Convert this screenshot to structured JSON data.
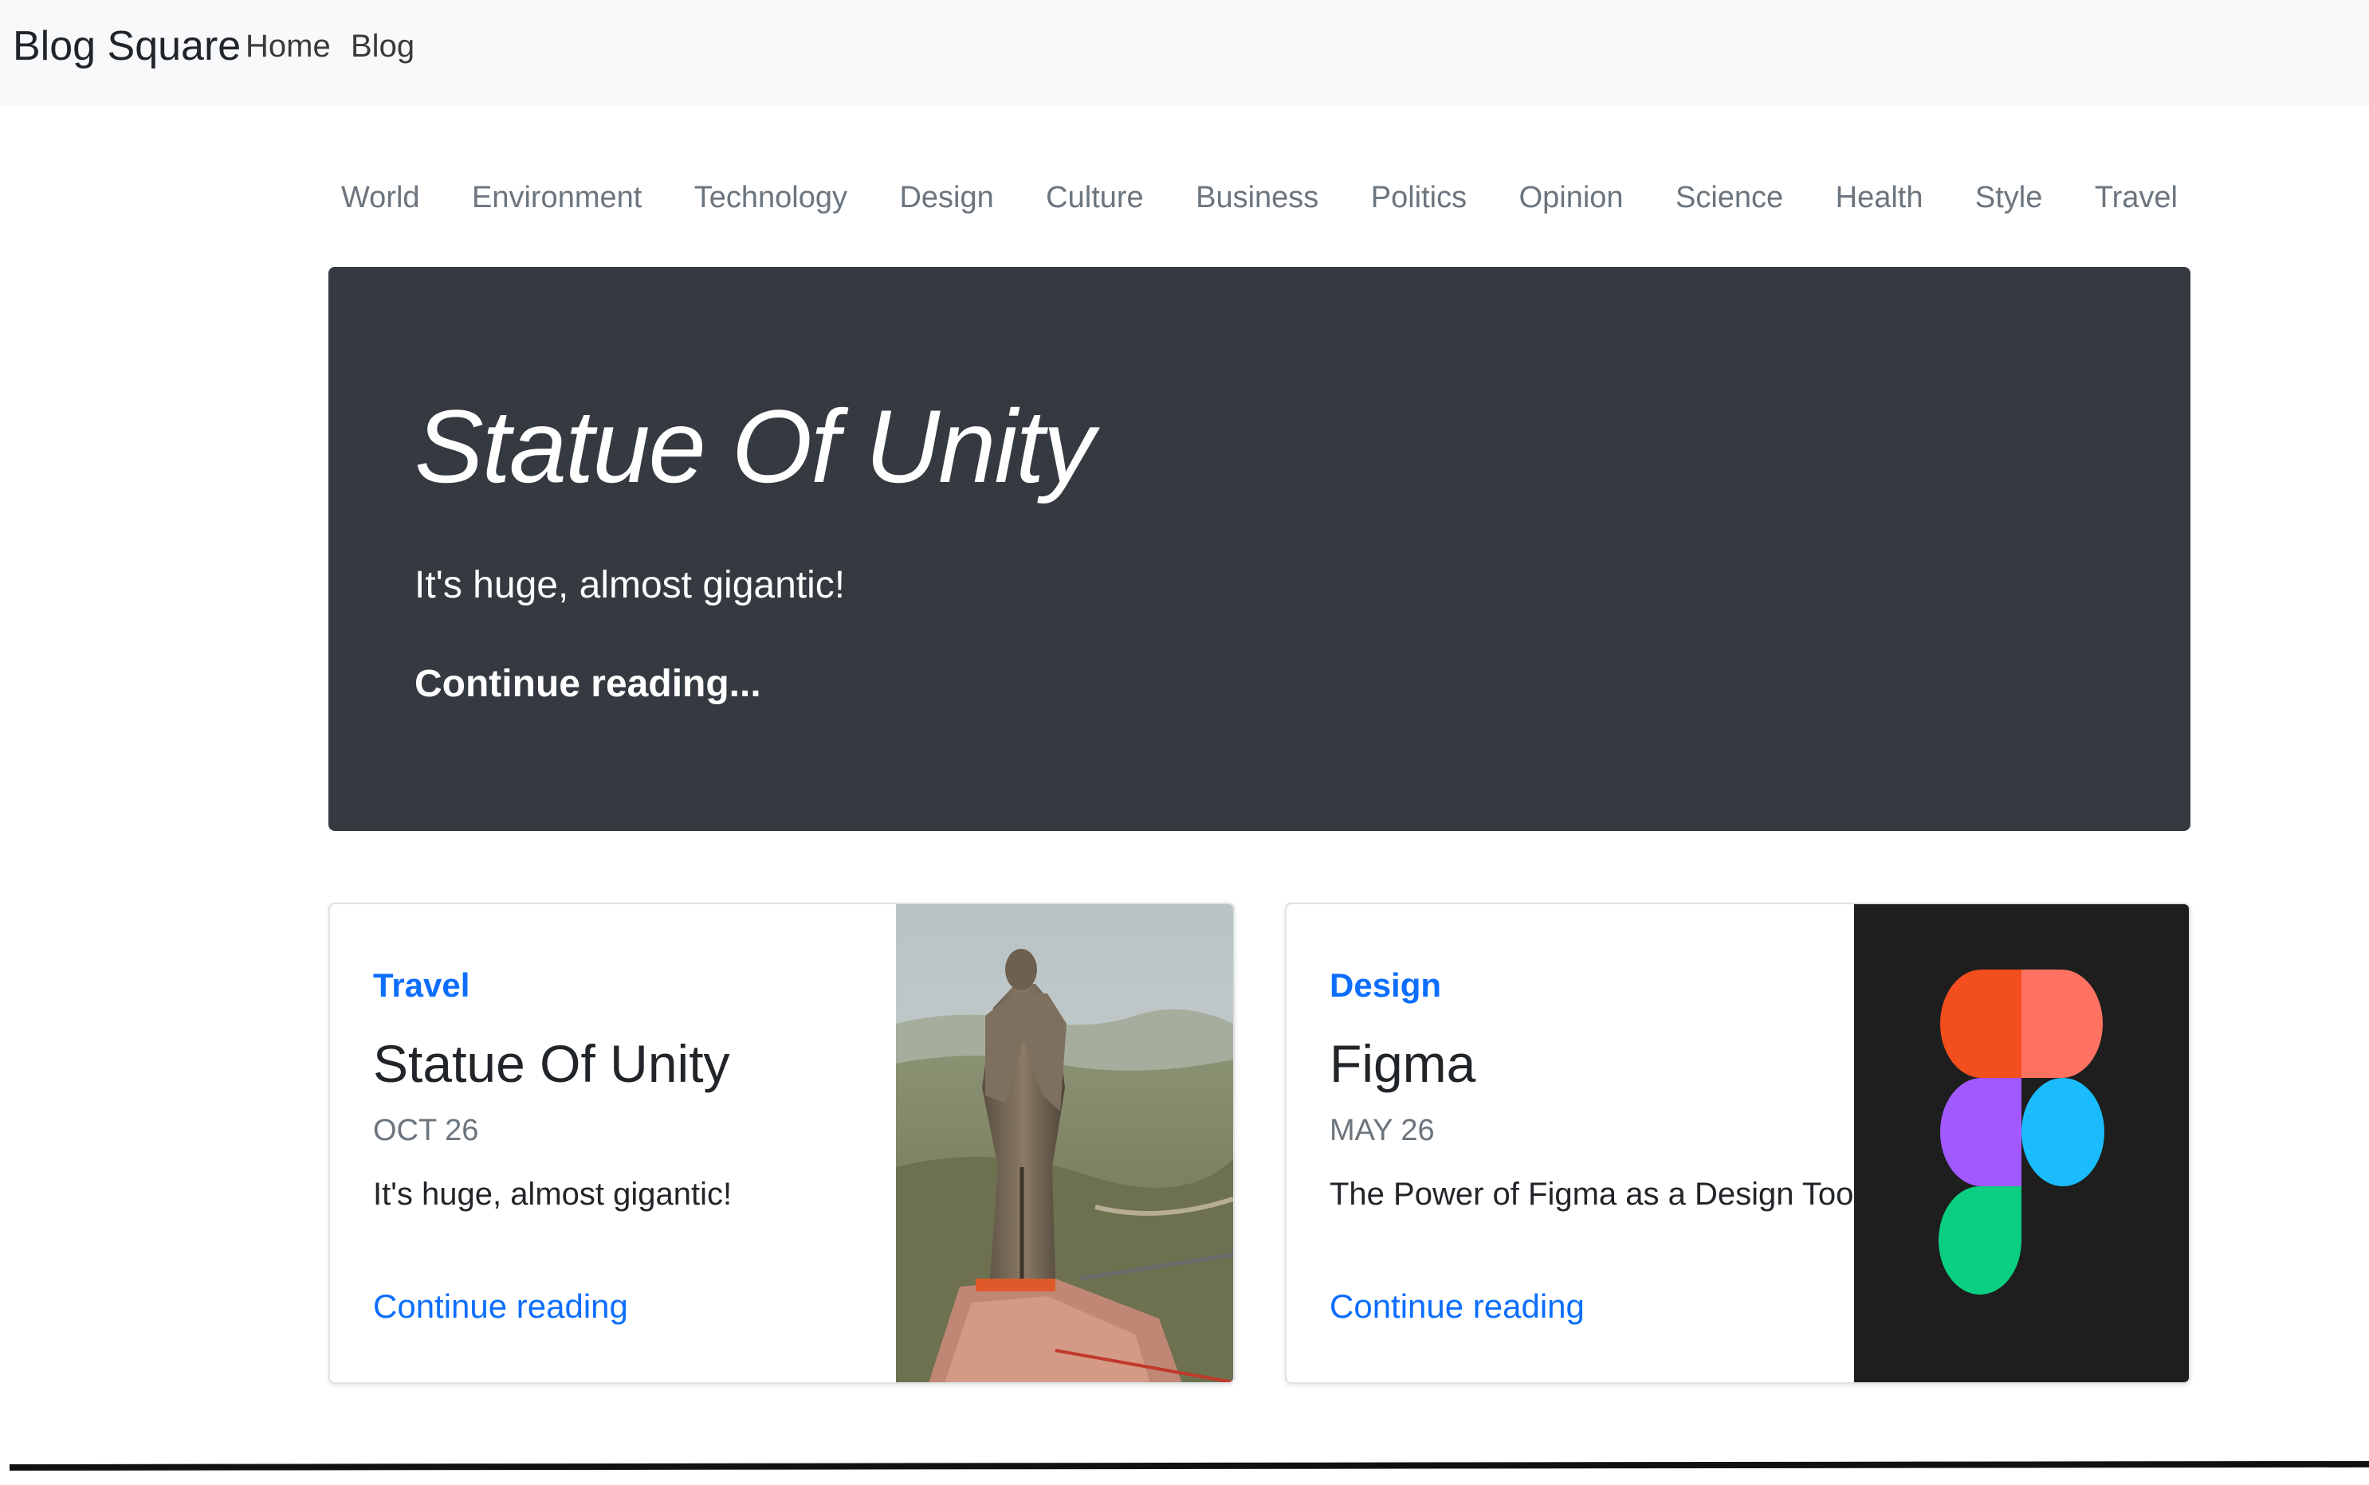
{
  "navbar": {
    "brand": "Blog Square",
    "links": [
      "Home",
      "Blog"
    ]
  },
  "categories": [
    "World",
    "Environment",
    "Technology",
    "Design",
    "Culture",
    "Business",
    "Politics",
    "Opinion",
    "Science",
    "Health",
    "Style",
    "Travel"
  ],
  "hero": {
    "title": "Statue Of Unity",
    "lead": "It's huge, almost gigantic!",
    "link": "Continue reading..."
  },
  "cards": [
    {
      "category": "Travel",
      "title": "Statue Of Unity",
      "date": "OCT 26",
      "text": "It's huge, almost gigantic!",
      "link": "Continue reading",
      "category_color": "#0d6efd",
      "image": "statue-of-unity-photo"
    },
    {
      "category": "Design",
      "title": "Figma",
      "date": "MAY 26",
      "text": "The Power of Figma as a Design Tool",
      "link": "Continue reading",
      "category_color": "#0d6efd",
      "image": "figma-logo"
    }
  ],
  "colors": {
    "navbar_bg": "#f8f9fa",
    "hero_bg": "#343a40",
    "link_blue": "#0d6efd",
    "muted": "#6c757d",
    "figma_bg": "#1e1e1e",
    "figma_red": "#f24e1e",
    "figma_salmon": "#ff7262",
    "figma_purple": "#a259ff",
    "figma_blue": "#1abcfe",
    "figma_green": "#0acf83"
  }
}
